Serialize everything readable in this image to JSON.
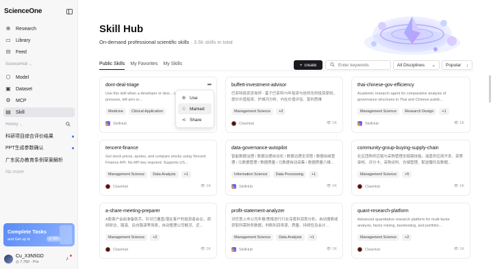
{
  "app": {
    "logo": "ScienceOne"
  },
  "sidebar": {
    "nav": [
      {
        "icon": "plus-circle-icon",
        "label": "Research"
      },
      {
        "icon": "library-icon",
        "label": "Library"
      },
      {
        "icon": "feed-icon",
        "label": "Feed"
      }
    ],
    "section_hub": "ScienceHub",
    "hub_items": [
      {
        "icon": "cube-icon",
        "label": "Model"
      },
      {
        "icon": "dataset-icon",
        "label": "Dataset"
      },
      {
        "icon": "mcp-icon",
        "label": "MCP"
      },
      {
        "icon": "skill-icon",
        "label": "Skill"
      }
    ],
    "section_history": "History",
    "history": [
      {
        "label": "科研项目综合评价结果",
        "unread": true
      },
      {
        "label": "PPT生成参数确认",
        "unread": true
      },
      {
        "label": "广东民办教育条例草案解析",
        "unread": false
      }
    ],
    "more": "No more",
    "promo": {
      "title": "Complete Tasks",
      "subtitle": "and Get up to",
      "reward": "500"
    },
    "user": {
      "name": "Cu_X3N5GD",
      "points": "7,750",
      "tier": "Pro"
    }
  },
  "header": {
    "title": "Skill Hub",
    "subtitle": "On-demand professional scientific skills",
    "count": "3.5k skills in total"
  },
  "tabs": [
    "Public Skills",
    "My Favorites",
    "My Skills"
  ],
  "toolbar": {
    "create_label": "create",
    "search_placeholder": "Enter keywords",
    "discipline": "All Disciplines",
    "sort": "Popular"
  },
  "dropdown": [
    {
      "icon": "plus-circle-icon",
      "label": "Use"
    },
    {
      "icon": "star-icon",
      "label": "Marked"
    },
    {
      "icon": "share-icon",
      "label": "Share"
    }
  ],
  "cards": [
    {
      "title": "dont-deal-triage",
      "desc": "Use this skill when a developer or desi... chest pain, chest pressure, left arm or...",
      "tags": [
        "Medicine",
        "Clinical Application"
      ],
      "provider": "SkillHub",
      "provider_type": "sh",
      "views": "",
      "has_menu": true
    },
    {
      "title": "buffett-investment-advisor",
      "desc": "巴菲特投资咨询师 - 基于巴菲特70年投资与信仰化的投资原则，提价价值投资、护城河分析、内在价值评估、复利思维",
      "tags": [
        "Management Science",
        "+2"
      ],
      "provider": "ClawHub",
      "provider_type": "ch",
      "views": "1K",
      "has_menu": false
    },
    {
      "title": "thai-chinese-gov-efficiency",
      "desc": "Academic research agent for comparative analysis of governance structures in Thai and Chinese public...",
      "tags": [
        "Management Science",
        "Research Design",
        "+1"
      ],
      "provider": "SkillHub",
      "provider_type": "sh",
      "views": "1K",
      "has_menu": false
    },
    {
      "title": "tencent-finance",
      "desc": "Get stock prices, quotes, and compare stocks using Tencent Finance API. No API key required. Supports US...",
      "tags": [
        "Management Science",
        "Data Analysis",
        "+1"
      ],
      "provider": "ClawHub",
      "provider_type": "ch",
      "views": "1K",
      "has_menu": false
    },
    {
      "title": "data-governance-autopilot",
      "desc": "智能数据治理 / 数据治理自动化 / 数据治理全流程 / 数据血缘管理 / 元数据管理 / 数据质量 / 元数据自动采集 / 数据质量六维...",
      "tags": [
        "Information Science",
        "Data Processing",
        "+1"
      ],
      "provider": "SkillHub",
      "provider_type": "sh",
      "views": "1K",
      "has_menu": false
    },
    {
      "title": "community-group-buying-supply-chain",
      "desc": "社区团购供应链与采购管理全链路技能。涵盖供应商开发、资质审核、评分卡、采购谈判、仓储管理、配送履约及数据...",
      "tags": [
        "Management Science",
        "+5"
      ],
      "provider": "ClawHub",
      "provider_type": "ch",
      "views": "1K",
      "has_menu": false
    },
    {
      "title": "a-share-meeting-preparer",
      "desc": "A股客户会前准备助手。针对已覆盖/潜在客户的投资者会议，调研研访、路演、反向路演等场景，自动整理公司概况、近...",
      "tags": [
        "Management Science",
        "+2"
      ],
      "provider": "ClawHub",
      "provider_type": "ch",
      "views": "1K",
      "has_menu": false
    },
    {
      "title": "profit-statement-analyzer",
      "desc": "对任意上市公司年报/季报进行行业深度利润表分析。自动搜索或获取所需财务数据，判断利润来源、质量、持续性及会计...",
      "tags": [
        "Management Science",
        "Data Analysis",
        "+1"
      ],
      "provider": "SkillHub",
      "provider_type": "sh",
      "views": "1K",
      "has_menu": false
    },
    {
      "title": "quant-research-platform",
      "desc": "Advanced quantitative research platform for multi-factor analysis, factor mining, backtesting, and portfolio...",
      "tags": [
        "Management Science",
        "+2"
      ],
      "provider": "ClawHub",
      "provider_type": "ch",
      "views": "1K",
      "has_menu": false
    }
  ]
}
